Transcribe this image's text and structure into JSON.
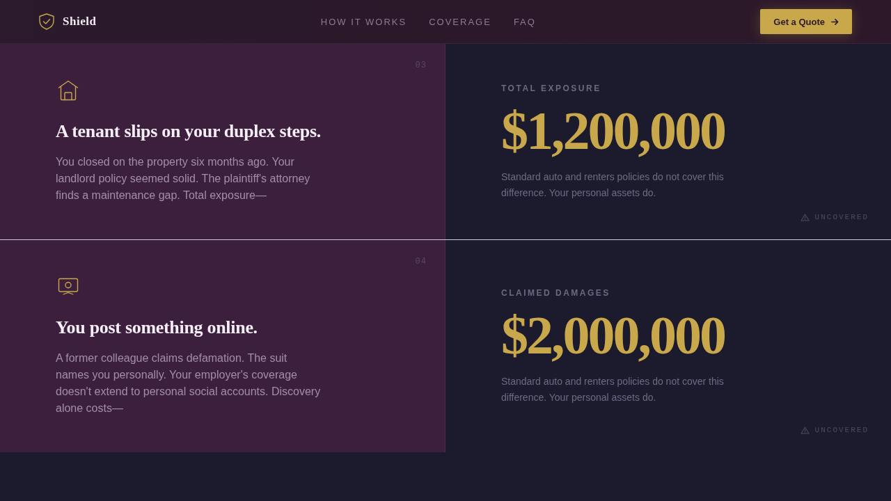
{
  "header": {
    "brand": "Shield",
    "links": [
      "HOW IT WORKS",
      "COVERAGE",
      "FAQ"
    ],
    "cta": "Get a Quote"
  },
  "scenarios": [
    {
      "number": "03",
      "kind": "property",
      "title": "A tenant slips on your duplex steps.",
      "body": "You closed on the property six months ago. Your landlord policy seemed solid. The plaintiff's attorney finds a maintenance gap. Total exposure—",
      "label": "TOTAL EXPOSURE",
      "amount": "$1,200,000",
      "note": "Standard auto and renters policies do not cover this difference. Your personal assets do.",
      "badge": "UNCOVERED"
    },
    {
      "number": "04",
      "kind": "online",
      "title": "You post something online.",
      "body": "A former colleague claims defamation. The suit names you personally. Your employer's coverage doesn't extend to personal social accounts. Discovery alone costs—",
      "label": "CLAIMED DAMAGES",
      "amount": "$2,000,000",
      "note": "Standard auto and renters policies do not cover this difference. Your personal assets do.",
      "badge": "UNCOVERED"
    }
  ]
}
